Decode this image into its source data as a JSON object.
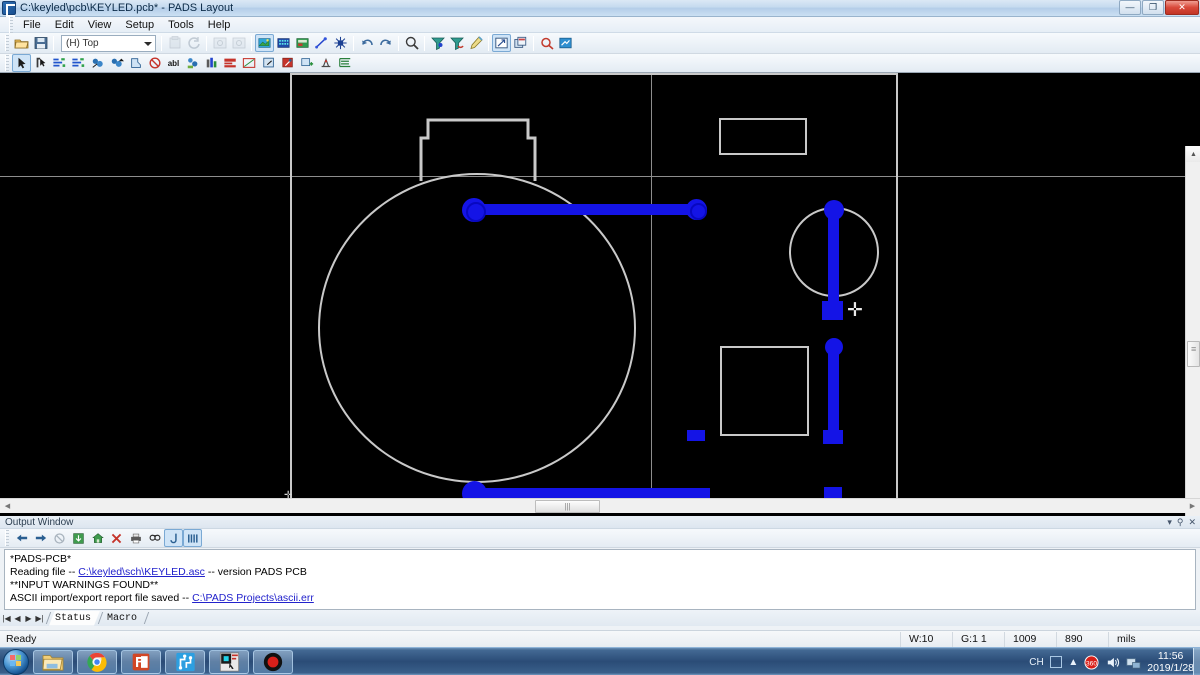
{
  "window": {
    "title": "C:\\keyled\\pcb\\KEYLED.pcb* - PADS Layout",
    "icon": "pads-layout-icon",
    "minimize_label": "—",
    "maximize_label": "❐",
    "close_label": "✕"
  },
  "menu": {
    "items": [
      {
        "label": "File"
      },
      {
        "label": "Edit"
      },
      {
        "label": "View"
      },
      {
        "label": "Setup"
      },
      {
        "label": "Tools"
      },
      {
        "label": "Help"
      }
    ]
  },
  "toolbar_main": {
    "open_label": "open-folder-icon",
    "save_label": "save-disk-icon",
    "layer_selector": {
      "value": "(H) Top",
      "placeholder": "(H) Top"
    },
    "buttons": [
      {
        "name": "print-preview-icon",
        "enabled": false
      },
      {
        "name": "refresh-icon",
        "enabled": false
      },
      {
        "name": "photo-plot-icon",
        "enabled": false
      },
      {
        "name": "photo-plot-2-icon",
        "enabled": false
      },
      {
        "name": "pcb-design-icon",
        "enabled": true,
        "active": true
      },
      {
        "name": "drafting-icon",
        "enabled": true
      },
      {
        "name": "plane-layer-icon",
        "enabled": true
      },
      {
        "name": "route-trace-icon",
        "enabled": true
      },
      {
        "name": "split-plane-icon",
        "enabled": true
      },
      {
        "name": "undo-icon",
        "enabled": true
      },
      {
        "name": "redo-icon",
        "enabled": true
      },
      {
        "name": "zoom-icon",
        "enabled": true
      },
      {
        "name": "filter-top-icon",
        "enabled": true
      },
      {
        "name": "filter-bottom-icon",
        "enabled": true
      },
      {
        "name": "highlight-icon",
        "enabled": true
      },
      {
        "name": "selection-mode-icon",
        "enabled": true,
        "active": true
      },
      {
        "name": "copy-window-icon",
        "enabled": true
      },
      {
        "name": "query-icon",
        "enabled": true
      },
      {
        "name": "ecad-link-icon",
        "enabled": true
      }
    ]
  },
  "toolbar_design": {
    "buttons": [
      {
        "name": "select-arrow-icon",
        "active": true
      },
      {
        "name": "select-shape-icon"
      },
      {
        "name": "route-manual-icon"
      },
      {
        "name": "route-bus-icon"
      },
      {
        "name": "move-part-icon"
      },
      {
        "name": "swap-part-icon"
      },
      {
        "name": "rotate-part-icon"
      },
      {
        "name": "no-route-icon"
      },
      {
        "name": "abl-label-icon"
      },
      {
        "name": "cluster-icon"
      },
      {
        "name": "dimension-icon"
      },
      {
        "name": "copper-pour-icon"
      },
      {
        "name": "plane-area-icon"
      },
      {
        "name": "board-outline-icon"
      },
      {
        "name": "drc-check-icon"
      },
      {
        "name": "add-component-icon"
      },
      {
        "name": "test-point-icon"
      },
      {
        "name": "layer-list-icon"
      }
    ]
  },
  "canvas": {
    "background_color": "#000000",
    "silkscreen_color": "#c9c9c9",
    "copper_color": "#1414e6",
    "grid_line_color": "#8d8d8d",
    "cursor": "crosshair-cursor",
    "board_outline_name": "board-outline"
  },
  "output_window": {
    "title": "Output Window",
    "title_buttons": [
      {
        "name": "dropdown-icon",
        "label": "▾"
      },
      {
        "name": "pin-icon",
        "label": "⚲"
      },
      {
        "name": "close-icon",
        "label": "✕"
      }
    ],
    "toolbar": [
      {
        "name": "back-arrow-icon",
        "label": "←"
      },
      {
        "name": "forward-arrow-icon",
        "label": "→"
      },
      {
        "name": "stop-icon",
        "label": "⊘"
      },
      {
        "name": "refresh-icon",
        "label": "⬇"
      },
      {
        "name": "home-icon",
        "label": "⌂"
      },
      {
        "name": "delete-icon",
        "label": "✕"
      },
      {
        "name": "print-icon",
        "label": "🖶"
      },
      {
        "name": "find-icon",
        "label": "🔍"
      },
      {
        "name": "wrap-text-icon",
        "label": "J"
      },
      {
        "name": "columns-icon",
        "label": "▥"
      }
    ],
    "lines": [
      {
        "parts": [
          {
            "type": "text",
            "value": "*PADS-PCB*"
          }
        ]
      },
      {
        "parts": [
          {
            "type": "text",
            "value": "Reading file -- "
          },
          {
            "type": "link",
            "value": "C:\\keyled\\sch\\KEYLED.asc"
          },
          {
            "type": "text",
            "value": "  -- version PADS PCB"
          }
        ]
      },
      {
        "parts": [
          {
            "type": "text",
            "value": "**INPUT WARNINGS FOUND**"
          }
        ]
      },
      {
        "parts": [
          {
            "type": "text",
            "value": "ASCII import/export report file saved -- "
          },
          {
            "type": "link",
            "value": "C:\\PADS Projects\\ascii.err"
          }
        ]
      }
    ],
    "tab_nav": [
      "|◀",
      "◀",
      "▶",
      "▶|"
    ],
    "tabs": [
      {
        "label": "Status",
        "active": true
      },
      {
        "label": "Macro",
        "active": false
      }
    ]
  },
  "statusbar": {
    "ready": "Ready",
    "cells": [
      {
        "name": "width-indicator",
        "label": "W:10"
      },
      {
        "name": "grid-indicator",
        "label": "G:1 1"
      },
      {
        "name": "x-coordinate",
        "label": "1009"
      },
      {
        "name": "y-coordinate",
        "label": "890"
      },
      {
        "name": "units-indicator",
        "label": "mils"
      }
    ]
  },
  "taskbar": {
    "start_button": "start-orb-icon",
    "tasks": [
      {
        "name": "file-explorer-icon"
      },
      {
        "name": "google-chrome-icon"
      },
      {
        "name": "powerpoint-icon"
      },
      {
        "name": "pads-logic-icon"
      },
      {
        "name": "pads-layout-icon"
      },
      {
        "name": "screen-recorder-icon"
      }
    ],
    "tray": {
      "ime_label": "CH",
      "ime_box_label": "",
      "show_hidden_label": "▲",
      "icons": [
        "antivirus-icon",
        "volume-icon",
        "network-icon"
      ],
      "time": "11:56",
      "date": "2019/1/28"
    }
  }
}
